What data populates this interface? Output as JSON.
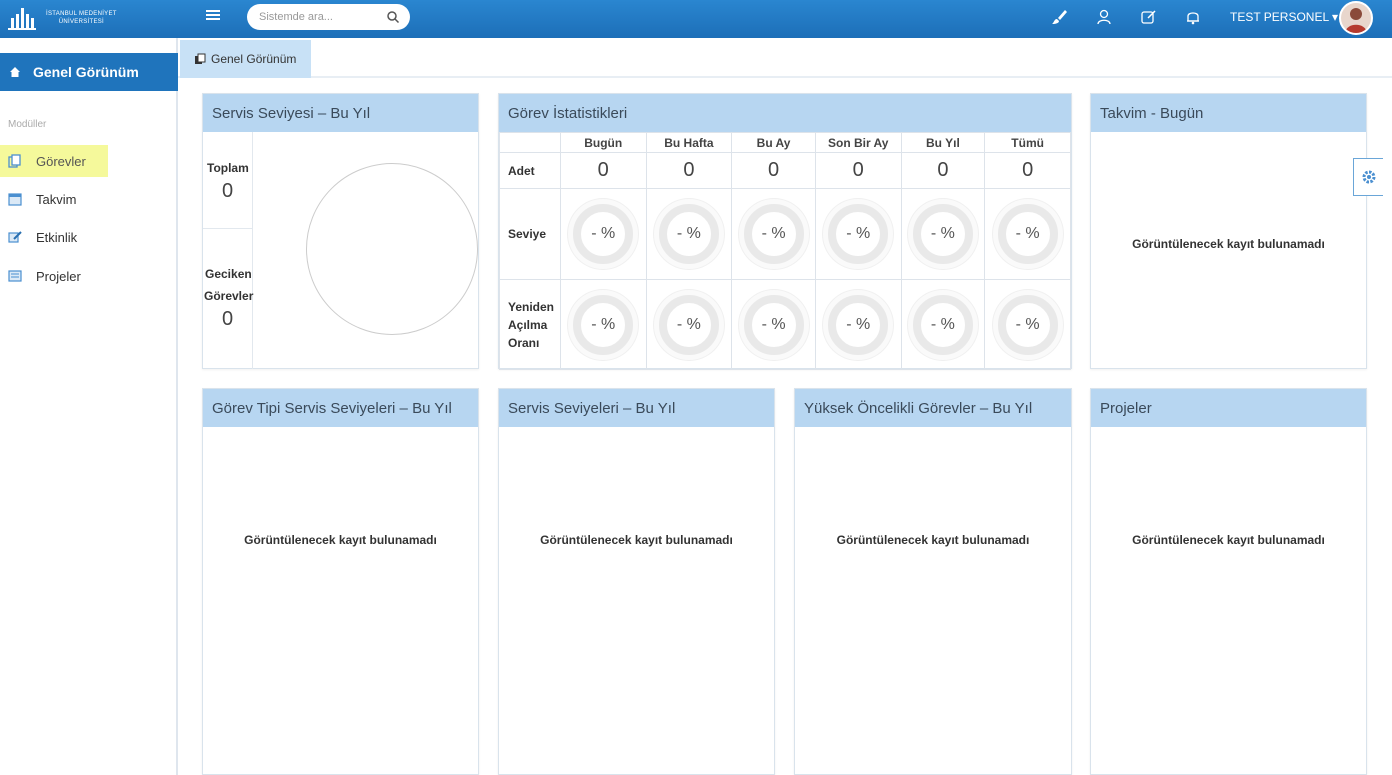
{
  "brand": {
    "name_line1": "İSTANBUL MEDENİYET",
    "name_line2": "ÜNİVERSİTESİ"
  },
  "search": {
    "placeholder": "Sistemde ara..."
  },
  "user": {
    "name": "TEST PERSONEL ▾"
  },
  "sidebar": {
    "active": "Genel Görünüm",
    "section": "Modüller",
    "items": [
      {
        "label": "Görevler"
      },
      {
        "label": "Takvim"
      },
      {
        "label": "Etkinlik"
      },
      {
        "label": "Projeler"
      }
    ]
  },
  "tab": {
    "label": "Genel Görünüm"
  },
  "panels": {
    "service_level": {
      "title": "Servis Seviyesi – Bu Yıl",
      "total_label": "Toplam",
      "total_value": "0",
      "late_label_1": "Geciken",
      "late_label_2": "Görevler",
      "late_value": "0"
    },
    "task_stats": {
      "title": "Görev İstatistikleri",
      "columns": [
        "Bugün",
        "Bu Hafta",
        "Bu Ay",
        "Son Bir Ay",
        "Bu Yıl",
        "Tümü"
      ],
      "row_count_label": "Adet",
      "counts": [
        "0",
        "0",
        "0",
        "0",
        "0",
        "0"
      ],
      "row_level_label": "Seviye",
      "levels": [
        "- %",
        "- %",
        "- %",
        "- %",
        "- %",
        "- %"
      ],
      "row_reopen_label_1": "Yeniden",
      "row_reopen_label_2": "Açılma",
      "row_reopen_label_3": "Oranı",
      "reopen": [
        "- %",
        "- %",
        "- %",
        "- %",
        "- %",
        "- %"
      ]
    },
    "calendar": {
      "title": "Takvim - Bugün",
      "empty": "Görüntülenecek kayıt bulunamadı"
    },
    "task_type": {
      "title": "Görev Tipi Servis Seviyeleri – Bu Yıl",
      "empty": "Görüntülenecek kayıt bulunamadı"
    },
    "service_levels": {
      "title": "Servis Seviyeleri – Bu Yıl",
      "empty": "Görüntülenecek kayıt bulunamadı"
    },
    "high_priority": {
      "title": "Yüksek Öncelikli Görevler – Bu Yıl",
      "empty": "Görüntülenecek kayıt bulunamadı"
    },
    "projects": {
      "title": "Projeler",
      "empty": "Görüntülenecek kayıt bulunamadı"
    }
  },
  "colors": {
    "topbar": "#1d6fb8",
    "active": "#1f74bc",
    "panel_head": "#b7d6f1",
    "highlight": "#f5f99b"
  }
}
